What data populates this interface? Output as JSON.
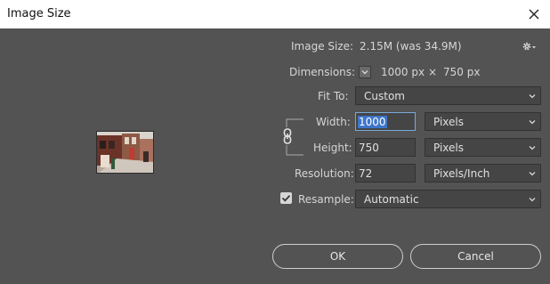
{
  "window": {
    "title": "Image Size"
  },
  "image_size": {
    "label": "Image Size:",
    "value": "2.15M (was 34.9M)"
  },
  "dimensions": {
    "label": "Dimensions:",
    "width_value": "1000 px",
    "times": "×",
    "height_value": "750 px"
  },
  "fit_to": {
    "label": "Fit To:",
    "selected": "Custom"
  },
  "width": {
    "label": "Width:",
    "value": "1000",
    "unit": "Pixels"
  },
  "height": {
    "label": "Height:",
    "value": "750",
    "unit": "Pixels"
  },
  "resolution": {
    "label": "Resolution:",
    "value": "72",
    "unit": "Pixels/Inch"
  },
  "resample": {
    "label": "Resample:",
    "checked": true,
    "selected": "Automatic"
  },
  "buttons": {
    "ok": "OK",
    "cancel": "Cancel"
  },
  "colors": {
    "dialog_bg": "#535353",
    "field_bg": "#454545",
    "focus_blue": "#3e75c9"
  }
}
